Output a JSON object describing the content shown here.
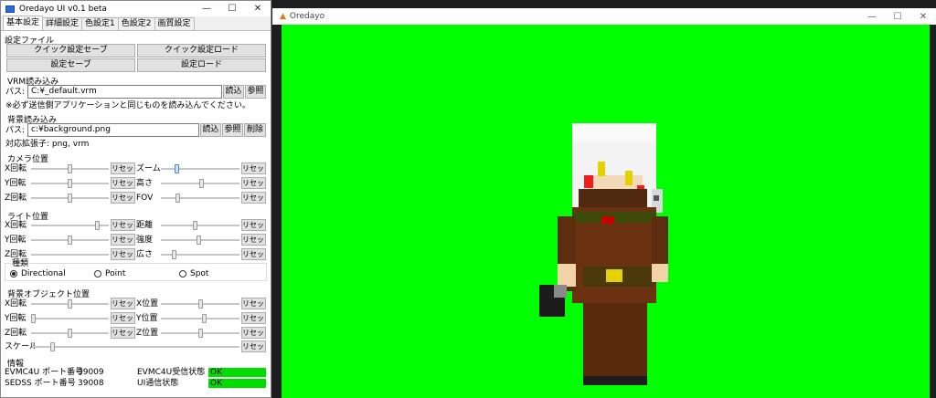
{
  "left_window": {
    "title": "Oredayo UI v0.1 beta",
    "tabs": [
      "基本設定",
      "詳細設定",
      "色設定1",
      "色設定2",
      "画質設定"
    ],
    "settings_file": {
      "header": "設定ファイル",
      "quick_save": "クイック設定セーブ",
      "quick_load": "クイック設定ロード",
      "save": "設定セーブ",
      "load": "設定ロード"
    },
    "vrm": {
      "header": "VRM読み込み",
      "path_label": "パス:",
      "path_value": "C:¥_default.vrm",
      "load_btn": "読込",
      "browse_btn": "参照",
      "note": "※必ず送信側アプリケーションと同じものを読み込んでください。"
    },
    "background": {
      "header": "背景読み込み",
      "path_label": "パス:",
      "path_value": "c:¥background.png",
      "load_btn": "読込",
      "browse_btn": "参照",
      "delete_btn": "削除",
      "ext_note": "対応拡張子: png, vrm"
    },
    "camera": {
      "header": "カメラ位置",
      "reset": "リセット",
      "left": [
        {
          "label": "X回転",
          "value": 0.5
        },
        {
          "label": "Y回転",
          "value": 0.5
        },
        {
          "label": "Z回転",
          "value": 0.5
        }
      ],
      "right": [
        {
          "label": "ズーム",
          "value": 0.18
        },
        {
          "label": "高さ",
          "value": 0.52
        },
        {
          "label": "FOV",
          "value": 0.2
        }
      ]
    },
    "light": {
      "header": "ライト位置",
      "reset": "リセット",
      "left": [
        {
          "label": "X回転",
          "value": 0.87
        },
        {
          "label": "Y回転",
          "value": 0.5
        },
        {
          "label": "Z回転",
          "value": null
        }
      ],
      "right": [
        {
          "label": "距離",
          "value": 0.43
        },
        {
          "label": "強度",
          "value": 0.48
        },
        {
          "label": "広さ",
          "value": 0.15
        }
      ],
      "kind_label": "種類",
      "kinds": [
        "Directional",
        "Point",
        "Spot"
      ],
      "selected": "Directional"
    },
    "bg_object": {
      "header": "背景オブジェクト位置",
      "reset": "リセット",
      "left": [
        {
          "label": "X回転",
          "value": 0.5
        },
        {
          "label": "Y回転",
          "value": 0.0
        },
        {
          "label": "Z回転",
          "value": 0.5
        }
      ],
      "right": [
        {
          "label": "X位置",
          "value": 0.5
        },
        {
          "label": "Y位置",
          "value": 0.55
        },
        {
          "label": "Z位置",
          "value": 0.5
        }
      ],
      "scale_label": "スケール",
      "scale_value": 0.09
    },
    "info": {
      "header": "情報",
      "rows": [
        {
          "label": "EVMC4U ポート番号",
          "value": "39009",
          "status_label": "EVMC4U受信状態",
          "status": "OK"
        },
        {
          "label": "SEDSS ポート番号",
          "value": "39008",
          "status_label": "UI通信状態",
          "status": "OK"
        }
      ]
    }
  },
  "right_window": {
    "title": "Oredayo",
    "background_color": "#00ff00"
  },
  "colors": {
    "ok": "#00dd00",
    "chroma": "#00ff00"
  },
  "icons": {
    "minimize": "minimize-icon",
    "maximize": "maximize-icon",
    "close": "close-icon"
  }
}
